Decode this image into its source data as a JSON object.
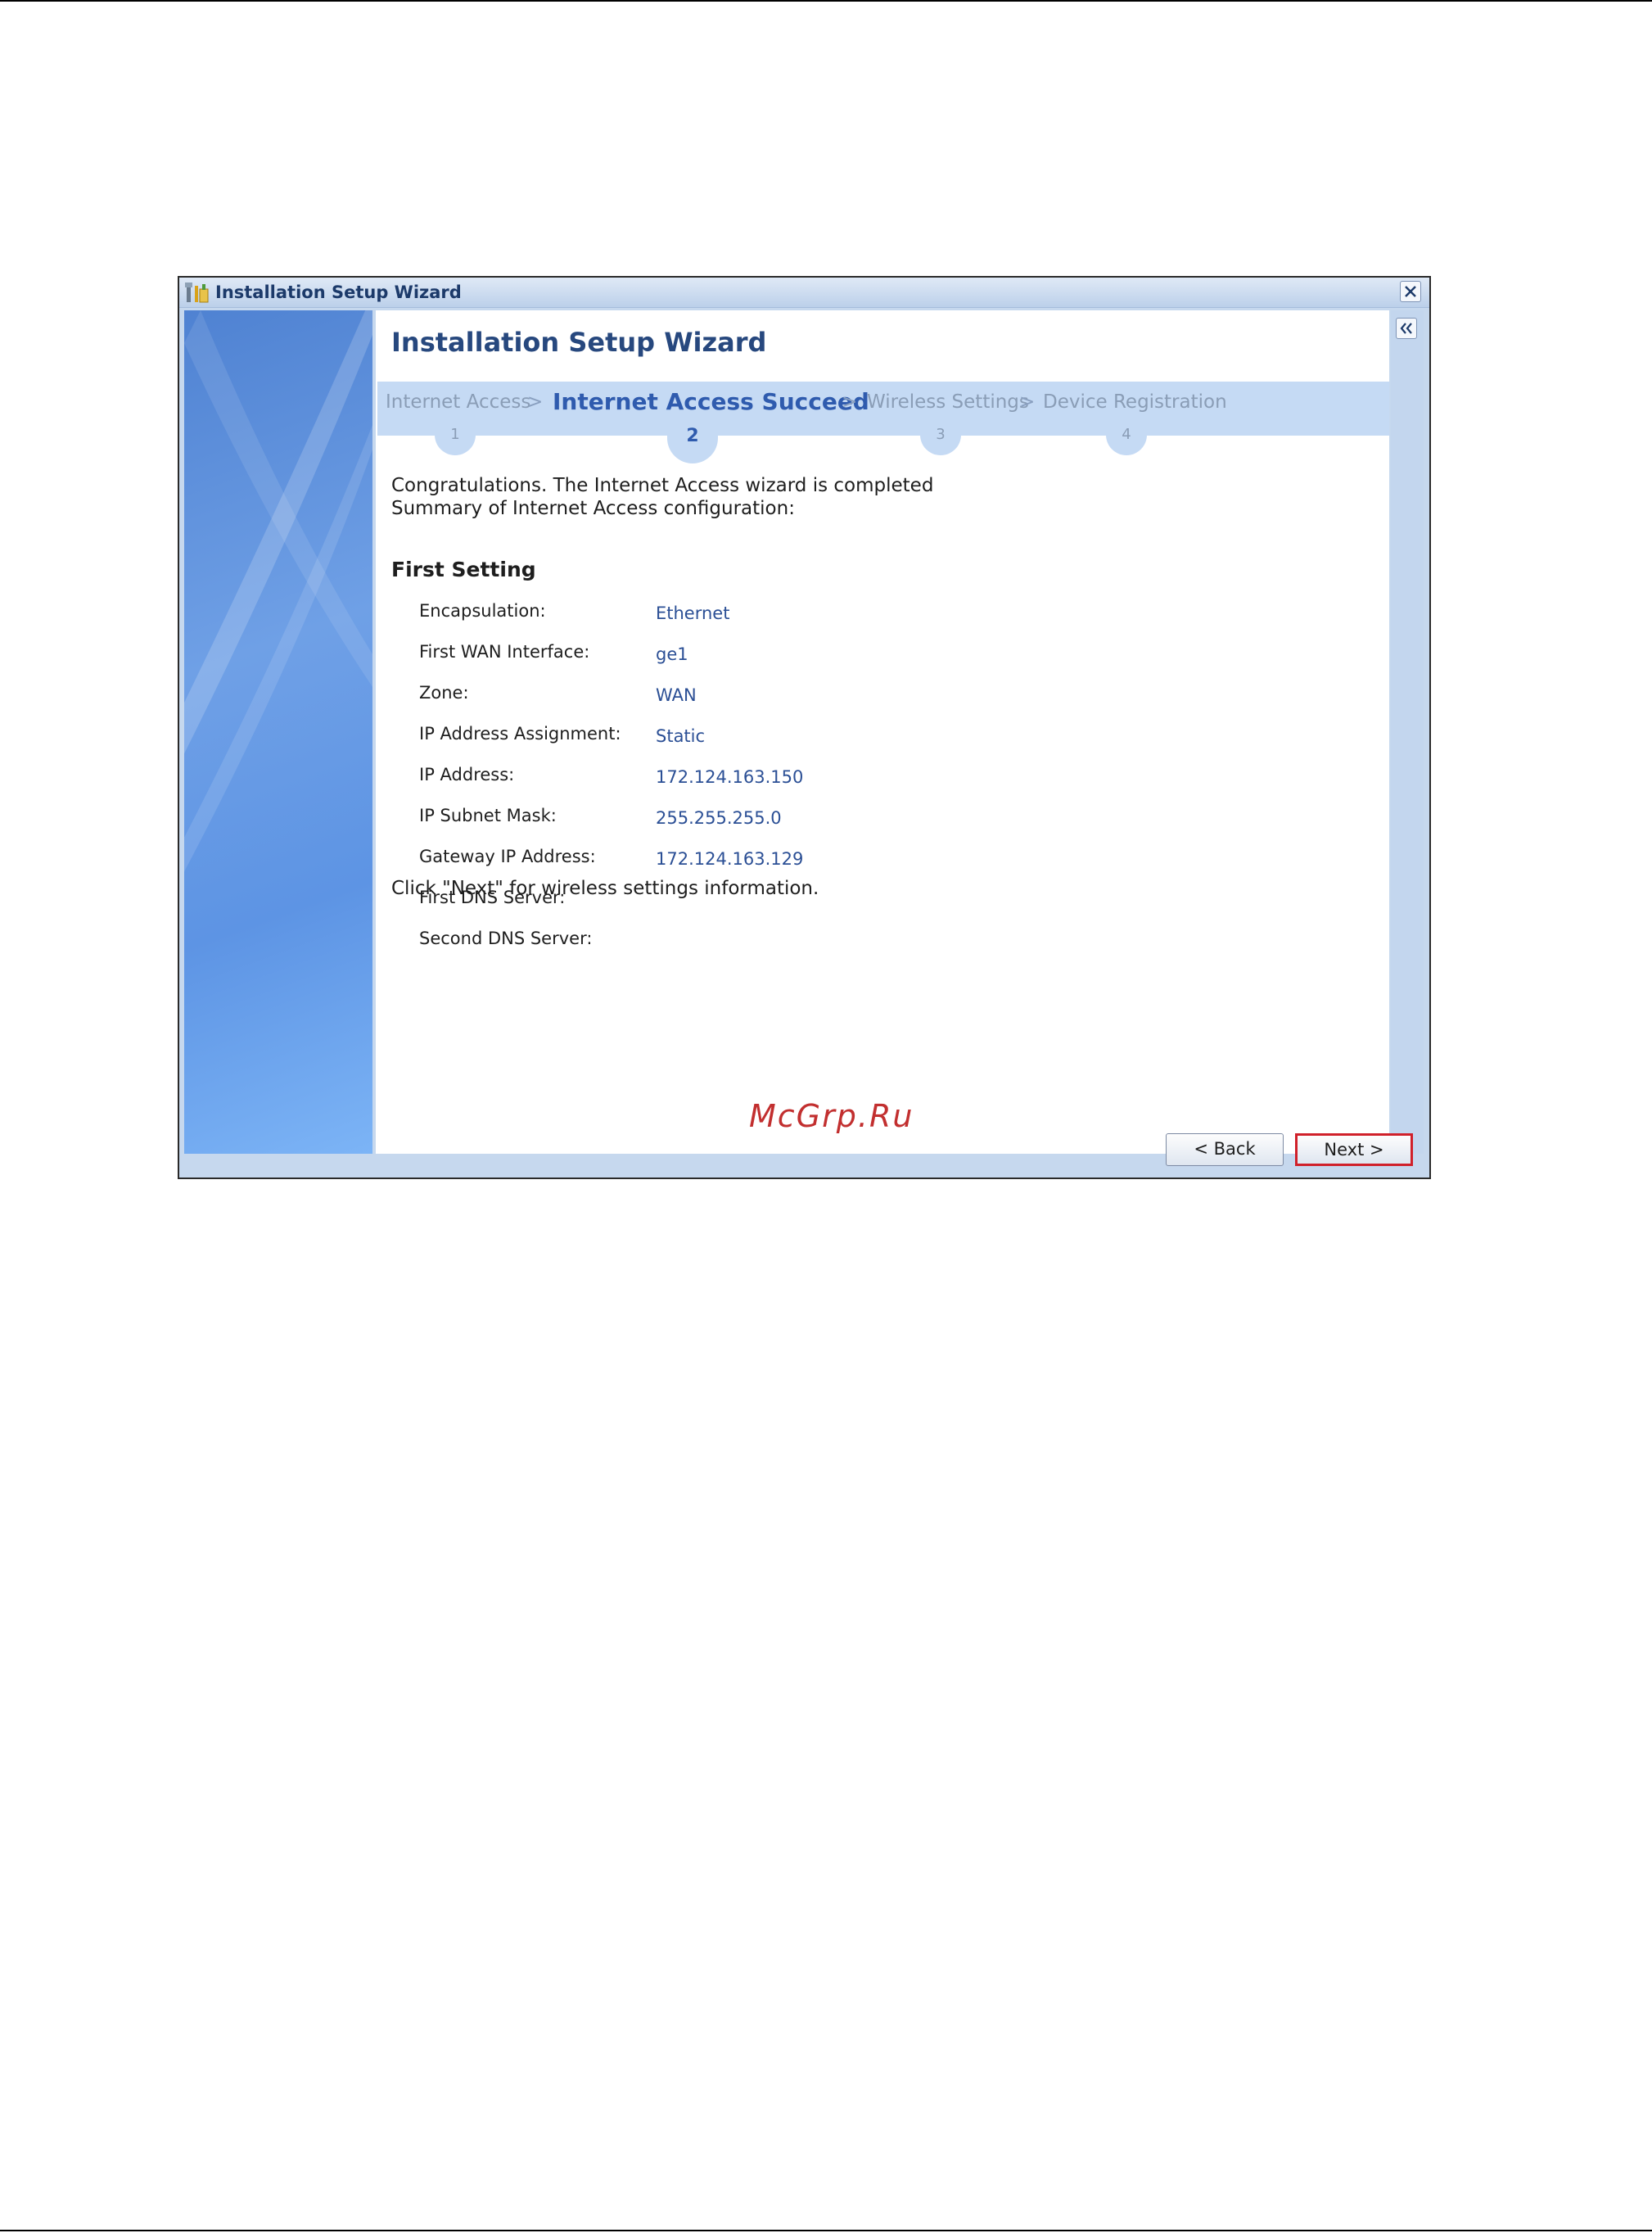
{
  "window": {
    "title": "Installation Setup Wizard",
    "content_title": "Installation Setup Wizard",
    "close_icon": "close-icon",
    "collapse_icon": "double-chevron-left-icon"
  },
  "steps": [
    {
      "label": "Internet Access",
      "number": "1",
      "active": false
    },
    {
      "label": "Internet Access Succeed",
      "number": "2",
      "active": true
    },
    {
      "label": "Wireless Settings",
      "number": "3",
      "active": false
    },
    {
      "label": "Device Registration",
      "number": "4",
      "active": false
    }
  ],
  "intro": {
    "line1": "Congratulations. The Internet Access wizard is completed",
    "line2": "Summary of Internet Access configuration:"
  },
  "section_title": "First Setting",
  "settings": [
    {
      "label": "Encapsulation:",
      "value": "Ethernet"
    },
    {
      "label": "First WAN Interface:",
      "value": "ge1"
    },
    {
      "label": "Zone:",
      "value": "WAN"
    },
    {
      "label": "IP Address Assignment:",
      "value": "Static"
    },
    {
      "label": "IP Address:",
      "value": "172.124.163.150"
    },
    {
      "label": "IP Subnet Mask:",
      "value": "255.255.255.0"
    },
    {
      "label": "Gateway IP Address:",
      "value": "172.124.163.129"
    },
    {
      "label": "First DNS Server:",
      "value": ""
    },
    {
      "label": "Second DNS Server:",
      "value": ""
    }
  ],
  "outro": "Click \"Next\" for wireless settings information.",
  "buttons": {
    "back": "< Back",
    "next": "Next >"
  },
  "watermark": "McGrp.Ru",
  "colors": {
    "accent": "#2f5bae",
    "highlight_border": "#d0202a",
    "step_bar": "#c5daf4"
  }
}
